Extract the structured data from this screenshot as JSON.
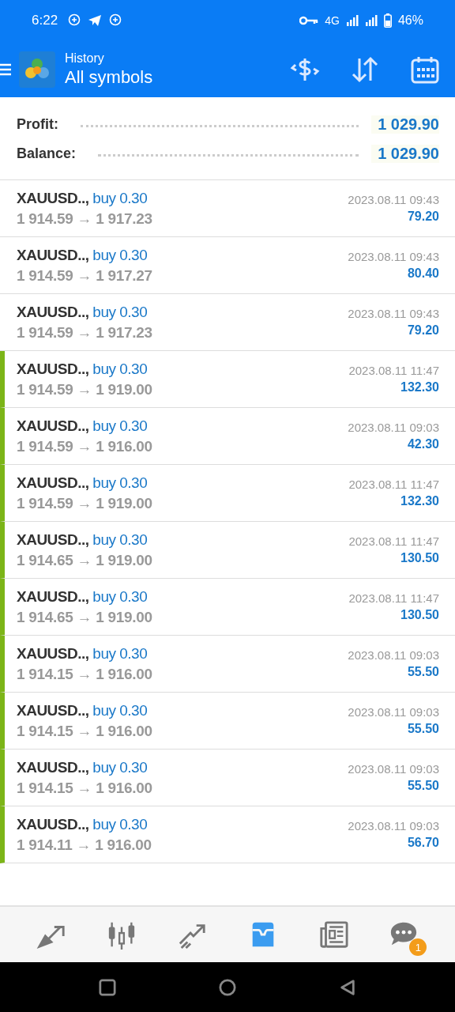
{
  "status_bar": {
    "time": "6:22",
    "network": "4G",
    "battery": "46%"
  },
  "header": {
    "section": "History",
    "title": "All symbols"
  },
  "summary": [
    {
      "label": "Profit:",
      "value": "1 029.90"
    },
    {
      "label": "Balance:",
      "value": "1 029.90"
    }
  ],
  "deals": [
    {
      "symbol": "XAUUSD..,",
      "side": "buy 0.30",
      "prices": "1 914.59 → 1 917.23",
      "time": "2023.08.11 09:43",
      "profit": "79.20",
      "marked": false
    },
    {
      "symbol": "XAUUSD..,",
      "side": "buy 0.30",
      "prices": "1 914.59 → 1 917.27",
      "time": "2023.08.11 09:43",
      "profit": "80.40",
      "marked": false
    },
    {
      "symbol": "XAUUSD..,",
      "side": "buy 0.30",
      "prices": "1 914.59 → 1 917.23",
      "time": "2023.08.11 09:43",
      "profit": "79.20",
      "marked": false
    },
    {
      "symbol": "XAUUSD..,",
      "side": "buy 0.30",
      "prices": "1 914.59 → 1 919.00",
      "time": "2023.08.11 11:47",
      "profit": "132.30",
      "marked": true
    },
    {
      "symbol": "XAUUSD..,",
      "side": "buy 0.30",
      "prices": "1 914.59 → 1 916.00",
      "time": "2023.08.11 09:03",
      "profit": "42.30",
      "marked": true
    },
    {
      "symbol": "XAUUSD..,",
      "side": "buy 0.30",
      "prices": "1 914.59 → 1 919.00",
      "time": "2023.08.11 11:47",
      "profit": "132.30",
      "marked": true
    },
    {
      "symbol": "XAUUSD..,",
      "side": "buy 0.30",
      "prices": "1 914.65 → 1 919.00",
      "time": "2023.08.11 11:47",
      "profit": "130.50",
      "marked": true
    },
    {
      "symbol": "XAUUSD..,",
      "side": "buy 0.30",
      "prices": "1 914.65 → 1 919.00",
      "time": "2023.08.11 11:47",
      "profit": "130.50",
      "marked": true
    },
    {
      "symbol": "XAUUSD..,",
      "side": "buy 0.30",
      "prices": "1 914.15 → 1 916.00",
      "time": "2023.08.11 09:03",
      "profit": "55.50",
      "marked": true
    },
    {
      "symbol": "XAUUSD..,",
      "side": "buy 0.30",
      "prices": "1 914.15 → 1 916.00",
      "time": "2023.08.11 09:03",
      "profit": "55.50",
      "marked": true
    },
    {
      "symbol": "XAUUSD..,",
      "side": "buy 0.30",
      "prices": "1 914.15 → 1 916.00",
      "time": "2023.08.11 09:03",
      "profit": "55.50",
      "marked": true
    },
    {
      "symbol": "XAUUSD..,",
      "side": "buy 0.30",
      "prices": "1 914.11 → 1 916.00",
      "time": "2023.08.11 09:03",
      "profit": "56.70",
      "marked": true
    }
  ],
  "bottom_nav": [
    {
      "kind": "trade",
      "selected": false
    },
    {
      "kind": "chart",
      "selected": false
    },
    {
      "kind": "quotes",
      "selected": false
    },
    {
      "kind": "history",
      "selected": true
    },
    {
      "kind": "news",
      "selected": false
    },
    {
      "kind": "chat",
      "selected": false,
      "badge": "1"
    }
  ]
}
